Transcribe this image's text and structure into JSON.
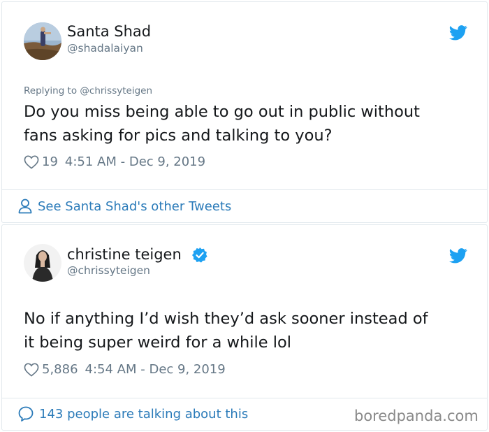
{
  "tweet1": {
    "name": "Santa Shad",
    "handle": "@shadalaiyan",
    "replying_to": "Replying to @chrissyteigen",
    "text_line1": "Do you miss being able to go out in public without",
    "text_line2": "fans asking for pics and talking to you?",
    "likes": "19",
    "timestamp": "4:51 AM - Dec 9, 2019",
    "footer_link": "See Santa Shad's other Tweets"
  },
  "tweet2": {
    "name": "christine teigen",
    "handle": "@chrissyteigen",
    "text_line1": "No if anything I’d wish they’d ask sooner instead of",
    "text_line2": "it being super weird for a while lol",
    "likes": "5,886",
    "timestamp": "4:54 AM - Dec 9, 2019",
    "footer_link": "143 people are talking about this"
  },
  "watermark": "boredpanda.com",
  "colors": {
    "twitter_blue": "#1da1f2",
    "link_blue": "#2b7bb9",
    "secondary_text": "#657786",
    "border": "#e1e8ed"
  },
  "icons": [
    "twitter-bird-icon",
    "heart-icon",
    "person-icon",
    "verified-badge-icon",
    "speech-bubble-icon"
  ]
}
